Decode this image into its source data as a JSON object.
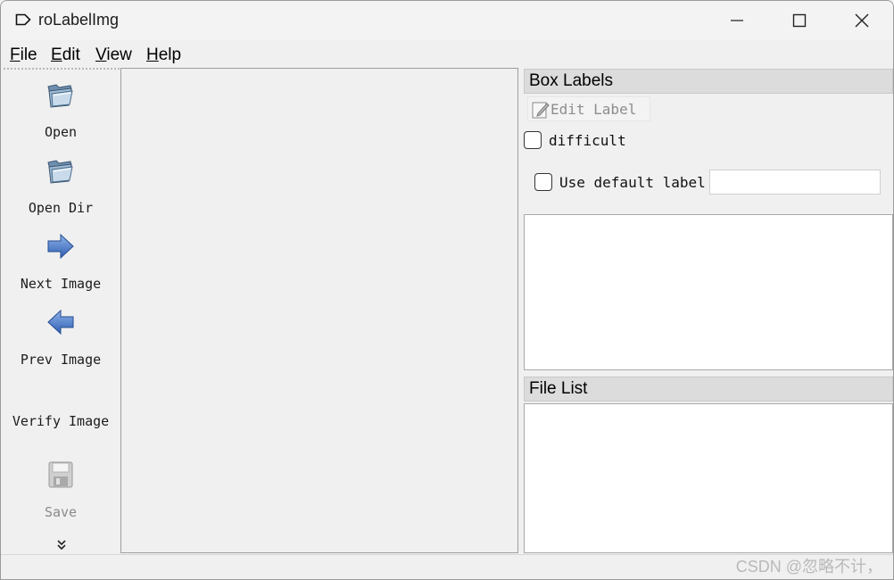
{
  "window": {
    "title": "roLabelImg"
  },
  "menu": {
    "file": {
      "mnemonic": "F",
      "rest": "ile"
    },
    "edit": {
      "mnemonic": "E",
      "rest": "dit"
    },
    "view": {
      "mnemonic": "V",
      "rest": "iew"
    },
    "help": {
      "mnemonic": "H",
      "rest": "elp"
    }
  },
  "toolbar": {
    "open": {
      "label": "Open",
      "icon": "folder-open-icon"
    },
    "open_dir": {
      "label": "Open Dir",
      "icon": "folder-open-icon"
    },
    "next_image": {
      "label": "Next Image",
      "icon": "arrow-right-icon"
    },
    "prev_image": {
      "label": "Prev Image",
      "icon": "arrow-left-icon"
    },
    "verify_image": {
      "label": "Verify Image"
    },
    "save": {
      "label": "Save",
      "icon": "floppy-disk-icon",
      "enabled": false
    },
    "extension": {
      "icon": "double-chevron-down-icon"
    }
  },
  "box_labels": {
    "title": "Box Labels",
    "edit_label": "Edit Label",
    "difficult": "difficult",
    "use_default_label": "Use default label",
    "default_label_value": ""
  },
  "file_list": {
    "title": "File List"
  },
  "status": {
    "watermark": "CSDN @忽略不计，"
  },
  "colors": {
    "window_bg": "#f0f0f0",
    "dock_title_bg": "#dcdcdc",
    "arrow_blue": "#3c6fc4"
  }
}
